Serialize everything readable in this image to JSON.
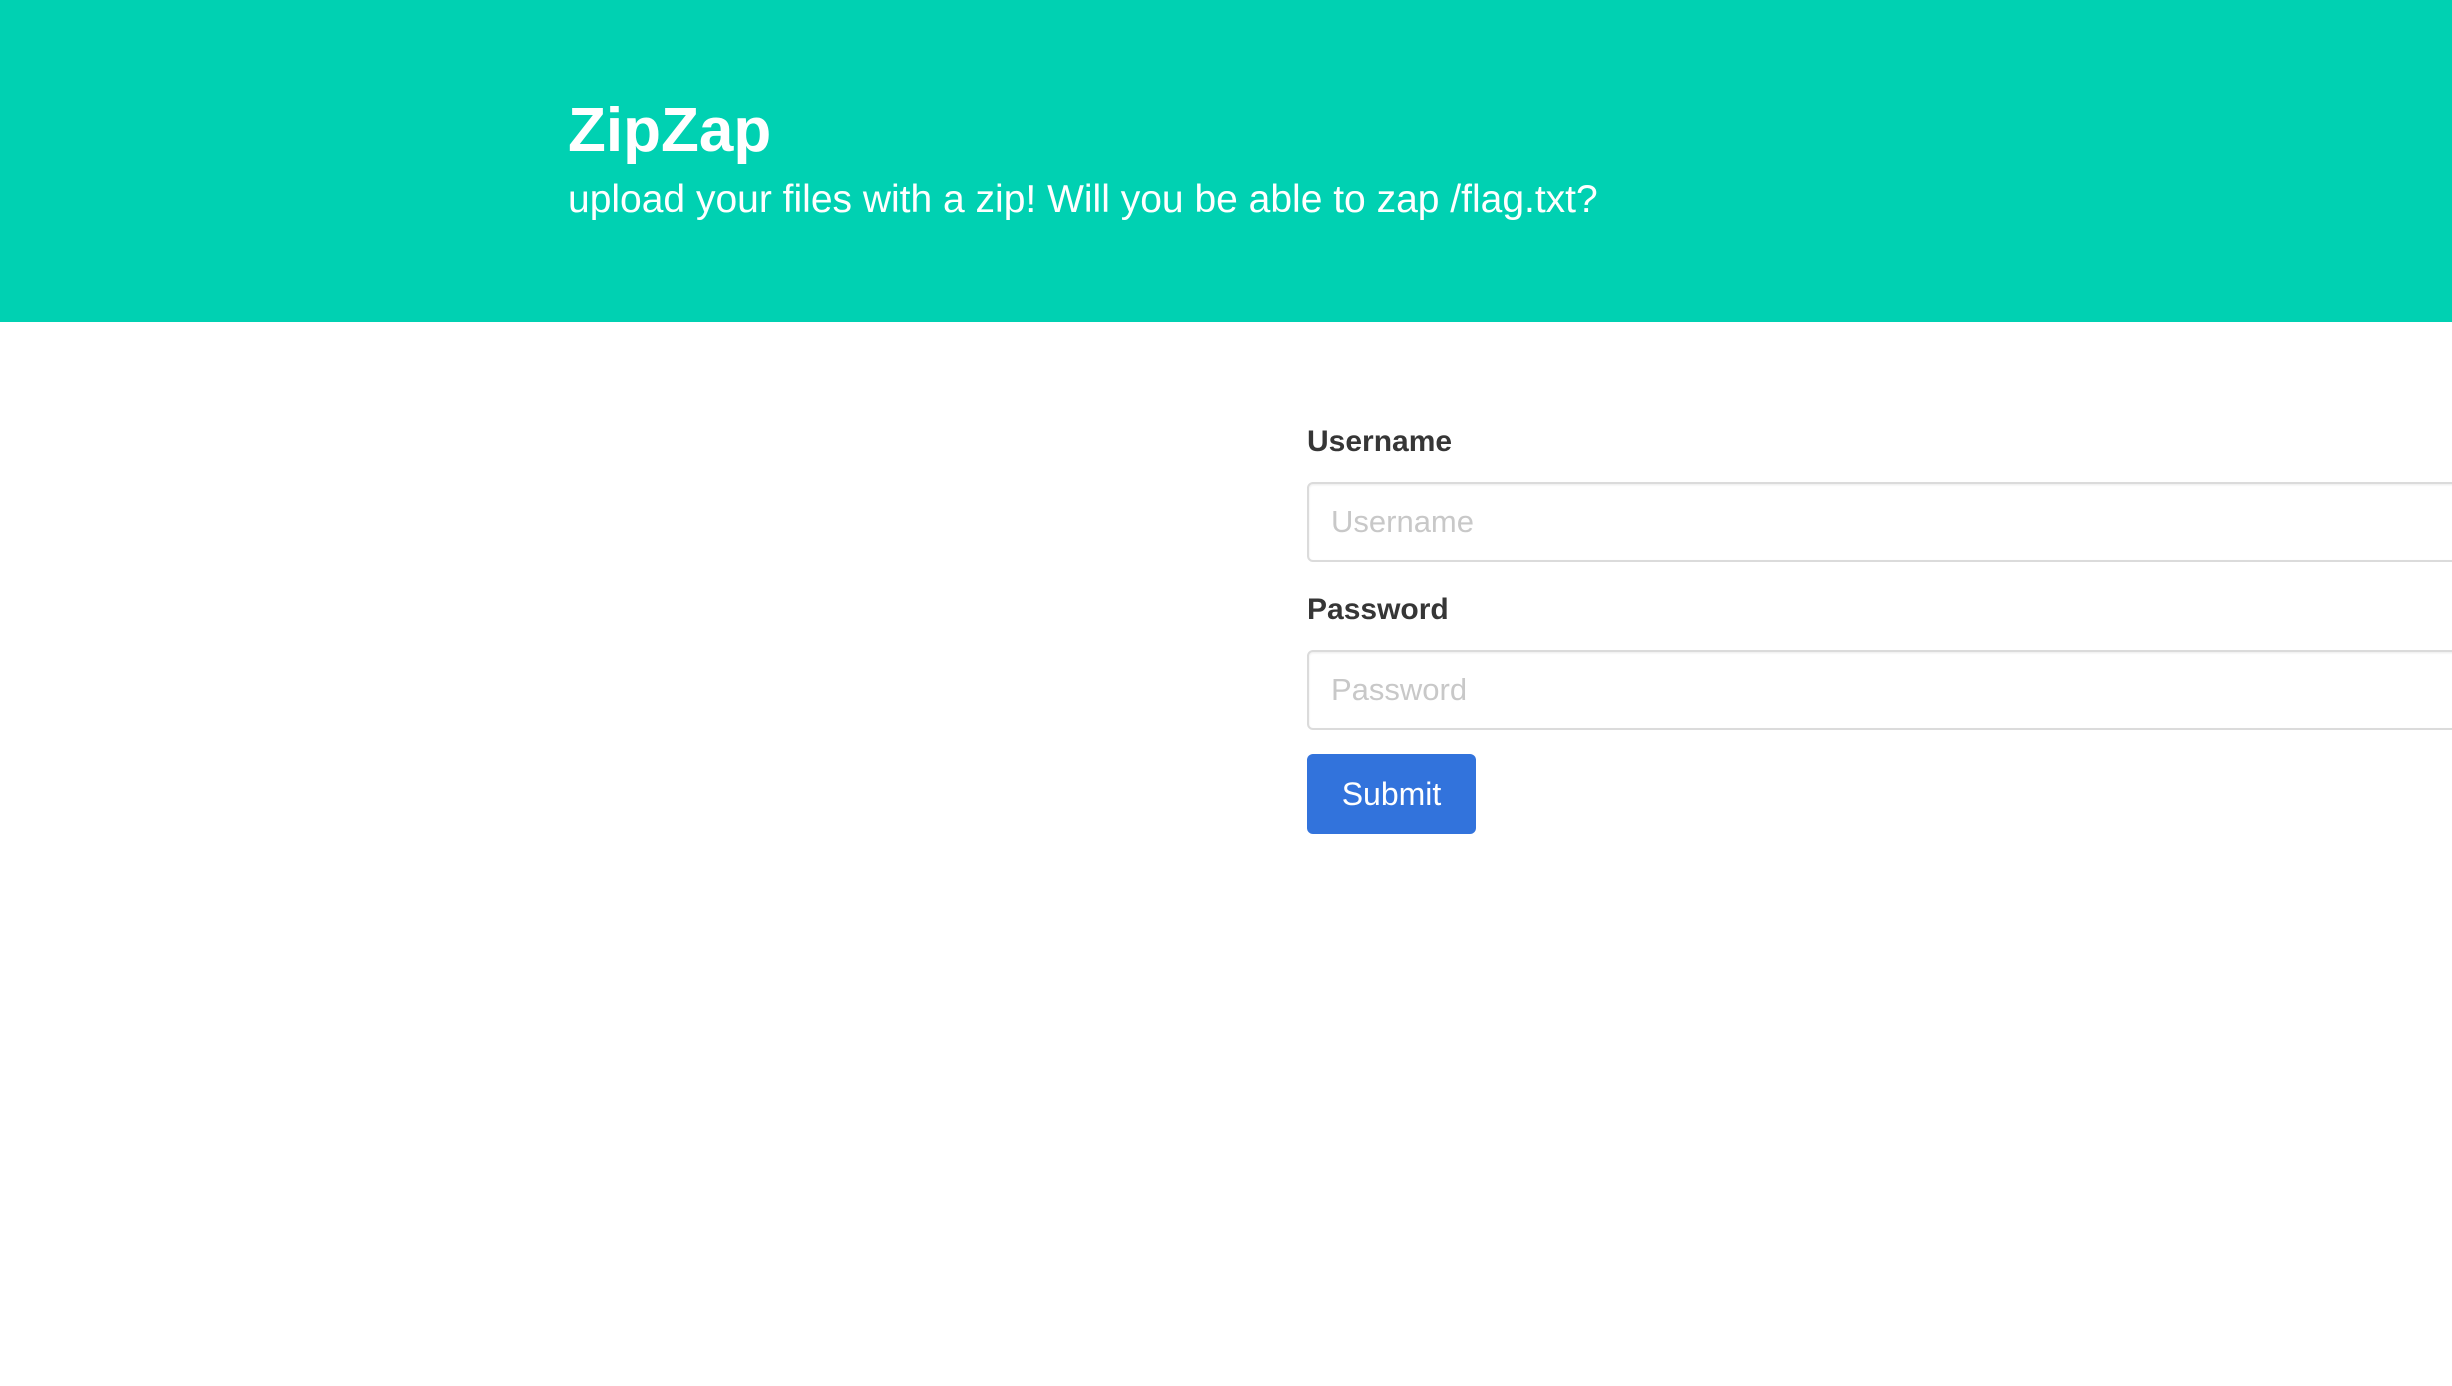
{
  "hero": {
    "title": "ZipZap",
    "subtitle": "upload your files with a zip! Will you be able to zap /flag.txt?",
    "background_color": "#00d1b2"
  },
  "login_form": {
    "username_label": "Username",
    "username_placeholder": "Username",
    "username_value": "",
    "password_label": "Password",
    "password_placeholder": "Password",
    "password_value": "",
    "submit_label": "Submit",
    "submit_color": "#3273dc"
  }
}
